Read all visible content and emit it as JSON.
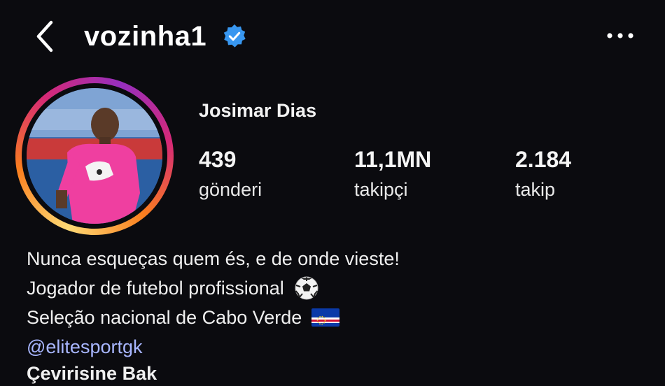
{
  "header": {
    "username": "vozinha1",
    "back_icon": "chevron-left-icon",
    "verified_icon": "verified-badge-icon",
    "more_icon": "more-horizontal-icon",
    "verified_color": "#3897f0"
  },
  "profile": {
    "full_name": "Josimar Dias",
    "avatar": "profile-photo"
  },
  "stats": {
    "posts": {
      "value": "439",
      "label": "gönderi"
    },
    "followers": {
      "value": "11,1MN",
      "label": "takipçi"
    },
    "following": {
      "value": "2.184",
      "label": "takip"
    }
  },
  "bio": {
    "line1": "Nunca esqueças quem és, e de onde vieste!",
    "line2": "Jogador de futebol profissional",
    "line2_emoji": "soccer-ball-icon",
    "line3": "Seleção nacional de Cabo Verde",
    "line3_emoji": "cape-verde-flag-icon",
    "link": "@elitesportgk",
    "translate": "Çevirisine Bak"
  },
  "colors": {
    "background": "#0b0b0f",
    "text": "#f5f5f5",
    "link": "#a8b6ff",
    "story_ring": [
      "#feda75",
      "#fa7e1e",
      "#d62976",
      "#962fbf"
    ]
  }
}
